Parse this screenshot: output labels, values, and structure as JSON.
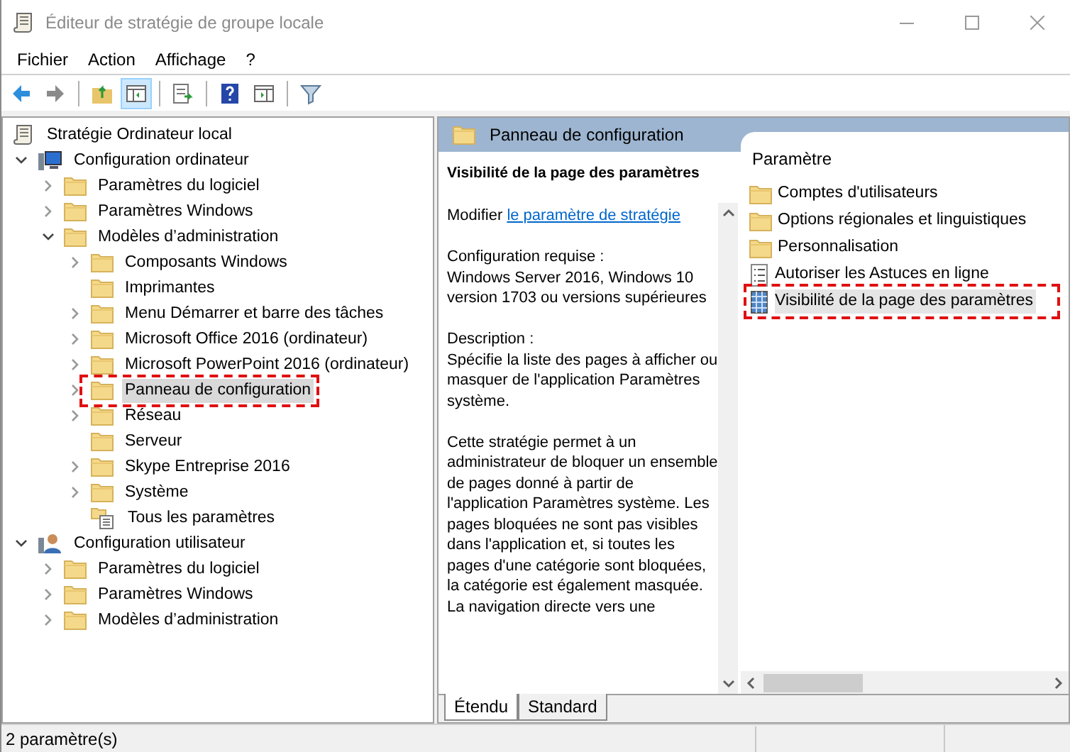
{
  "window": {
    "title": "Éditeur de stratégie de groupe locale"
  },
  "menu": [
    "Fichier",
    "Action",
    "Affichage",
    "?"
  ],
  "toolbar": [
    {
      "kind": "back",
      "pressed": false
    },
    {
      "kind": "forward",
      "pressed": false
    },
    {
      "kind": "sep"
    },
    {
      "kind": "up",
      "pressed": false
    },
    {
      "kind": "tree",
      "pressed": true
    },
    {
      "kind": "sep"
    },
    {
      "kind": "export",
      "pressed": false
    },
    {
      "kind": "sep"
    },
    {
      "kind": "help",
      "pressed": false
    },
    {
      "kind": "pane",
      "pressed": false
    },
    {
      "kind": "sep"
    },
    {
      "kind": "filter",
      "pressed": false
    }
  ],
  "tree": [
    {
      "label": "Stratégie Ordinateur local",
      "kind": "scroll",
      "selected": false,
      "children": [
        {
          "label": "Configuration ordinateur",
          "kind": "computer",
          "expanded": true,
          "selected": false,
          "children": [
            {
              "label": "Paramètres du logiciel",
              "kind": "folder",
              "expanded": false,
              "selected": false
            },
            {
              "label": "Paramètres Windows",
              "kind": "folder",
              "expanded": false,
              "selected": false
            },
            {
              "label": "Modèles d’administration",
              "kind": "folder",
              "expanded": true,
              "selected": false,
              "children": [
                {
                  "label": "Composants Windows",
                  "kind": "folder",
                  "expanded": false,
                  "selected": false
                },
                {
                  "label": "Imprimantes",
                  "kind": "folder",
                  "selected": false
                },
                {
                  "label": "Menu Démarrer et barre des tâches",
                  "kind": "folder",
                  "expanded": false,
                  "selected": false
                },
                {
                  "label": "Microsoft Office 2016 (ordinateur)",
                  "kind": "folder",
                  "expanded": false,
                  "selected": false
                },
                {
                  "label": "Microsoft PowerPoint 2016 (ordinateur)",
                  "kind": "folder",
                  "expanded": false,
                  "selected": false
                },
                {
                  "label": "Panneau de configuration",
                  "kind": "folder",
                  "expanded": false,
                  "selected": true,
                  "annotated": true
                },
                {
                  "label": "Réseau",
                  "kind": "folder",
                  "expanded": false,
                  "selected": false
                },
                {
                  "label": "Serveur",
                  "kind": "folder",
                  "selected": false
                },
                {
                  "label": "Skype Entreprise 2016",
                  "kind": "folder",
                  "expanded": false,
                  "selected": false
                },
                {
                  "label": "Système",
                  "kind": "folder",
                  "expanded": false,
                  "selected": false
                },
                {
                  "label": "Tous les paramètres",
                  "kind": "settings",
                  "selected": false
                }
              ]
            }
          ]
        },
        {
          "label": "Configuration utilisateur",
          "kind": "user",
          "expanded": true,
          "selected": false,
          "children": [
            {
              "label": "Paramètres du logiciel",
              "kind": "folder",
              "expanded": false,
              "selected": false
            },
            {
              "label": "Paramètres Windows",
              "kind": "folder",
              "expanded": false,
              "selected": false
            },
            {
              "label": "Modèles d’administration",
              "kind": "folder",
              "expanded": false,
              "selected": false
            }
          ]
        }
      ]
    }
  ],
  "details": {
    "header": "Panneau de configuration",
    "description": {
      "title": "Visibilité de la page des paramètres",
      "edit_prefix": "Modifier",
      "edit_link": "le paramètre de stratégie",
      "paragraphs": [
        "Configuration requise :\nWindows Server 2016, Windows 10 version 1703 ou versions supérieures",
        "Description :\nSpécifie la liste des pages à afficher ou masquer de l'application Paramètres système.",
        "Cette stratégie permet à un administrateur de bloquer un ensemble de pages donné à partir de l'application Paramètres système. Les pages bloquées ne sont pas visibles dans l'application et, si toutes les pages d'une catégorie sont bloquées, la catégorie est également masquée. La navigation directe vers une"
      ]
    },
    "list_column": "Paramètre",
    "items": [
      {
        "label": "Comptes d'utilisateurs",
        "kind": "folder",
        "selected": false
      },
      {
        "label": "Options régionales et linguistiques",
        "kind": "folder",
        "selected": false
      },
      {
        "label": "Personnalisation",
        "kind": "folder",
        "selected": false
      },
      {
        "label": "Autoriser les Astuces en ligne",
        "kind": "policy",
        "selected": false
      },
      {
        "label": "Visibilité de la page des paramètres",
        "kind": "policy-grid",
        "selected": true,
        "annotated": true
      }
    ],
    "tabs": [
      {
        "label": "Étendu",
        "selected": true
      },
      {
        "label": "Standard",
        "selected": false
      }
    ]
  },
  "status_bar": "2 paramètre(s)"
}
